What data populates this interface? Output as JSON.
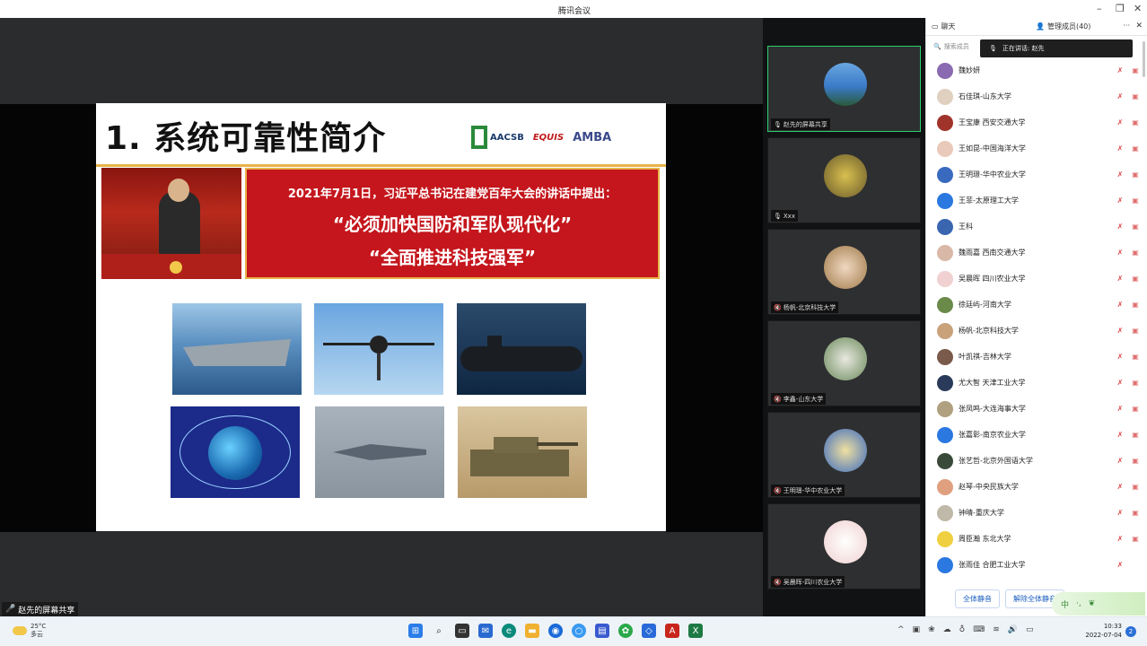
{
  "window": {
    "title": "腾讯会议",
    "minimize": "–",
    "restore": "❐",
    "close": "✕"
  },
  "slide": {
    "title": "1. 系统可靠性简介",
    "logos": {
      "aacsb": "AACSB",
      "aacsb_sub": "ACCREDITED",
      "equis": "EQUIS",
      "amba": "AMBA"
    },
    "headline": "2021年7月1日，习近平总书记在建党百年大会的讲话中提出：",
    "quote1": "“必须加快国防和军队现代化”",
    "quote2": "“全面推进科技强军”"
  },
  "share_label": "赵先的屏幕共享",
  "tiles": [
    {
      "name": "赵先的屏幕共享",
      "color": "#3a7ac8"
    },
    {
      "name": "Xxx",
      "color": "#b59a3a"
    },
    {
      "name": "杨帆-北京科技大学",
      "color": "#c9a27a"
    },
    {
      "name": "李鑫-山东大学",
      "color": "#6a8a5a"
    },
    {
      "name": "王明璟-华中农业大学",
      "color": "#3a6ac0"
    },
    {
      "name": "吴晨晖-四川农业大学",
      "color": "#f0e0dc"
    }
  ],
  "panel": {
    "tab_chat": "聊天",
    "tab_members": "管理成员(40)",
    "more": "···",
    "close": "✕",
    "search_placeholder": "搜索成员",
    "toast": "正在讲话: 赵先",
    "mute_all": "全体静音",
    "unmute_all": "解除全体静音",
    "ime": "中"
  },
  "members": [
    {
      "name": "魏妙妍",
      "color": "#8a6ab0"
    },
    {
      "name": "石佳琪-山东大学",
      "color": "#e0d0c0"
    },
    {
      "name": "王宝康 西安交通大学",
      "color": "#a0342a"
    },
    {
      "name": "王如昆-中国海洋大学",
      "color": "#e9c9b9"
    },
    {
      "name": "王明璟-华中农业大学",
      "color": "#3a6ac0"
    },
    {
      "name": "王菲-太原理工大学",
      "color": "#2a78e0"
    },
    {
      "name": "王科",
      "color": "#3a66b0"
    },
    {
      "name": "魏雨嘉 西南交通大学",
      "color": "#d9b8a8"
    },
    {
      "name": "吴晨晖 四川农业大学",
      "color": "#f0d0d0"
    },
    {
      "name": "徐廷屿-河南大学",
      "color": "#6a8a4a"
    },
    {
      "name": "杨帆-北京科技大学",
      "color": "#c9a27a"
    },
    {
      "name": "叶凯祺-吉林大学",
      "color": "#7a5a4a"
    },
    {
      "name": "尤大智 天津工业大学",
      "color": "#2a3a5a"
    },
    {
      "name": "张凤鸣-大连海事大学",
      "color": "#b0a080"
    },
    {
      "name": "张嘉彰-南京农业大学",
      "color": "#2a78e0"
    },
    {
      "name": "张艺哲-北京外国语大学",
      "color": "#3a4a3a"
    },
    {
      "name": "赵琴-中央民族大学",
      "color": "#e0a080"
    },
    {
      "name": "钟晴-重庆大学",
      "color": "#c0b8a8"
    },
    {
      "name": "周臣瀚 东北大学",
      "color": "#f0d040"
    },
    {
      "name": "张雨佳 合肥工业大学",
      "color": "#2a78e0"
    }
  ],
  "taskbar": {
    "temp": "25°C",
    "weather": "多云",
    "time": "10:33",
    "date": "2022-07-04",
    "notifications": "2"
  }
}
